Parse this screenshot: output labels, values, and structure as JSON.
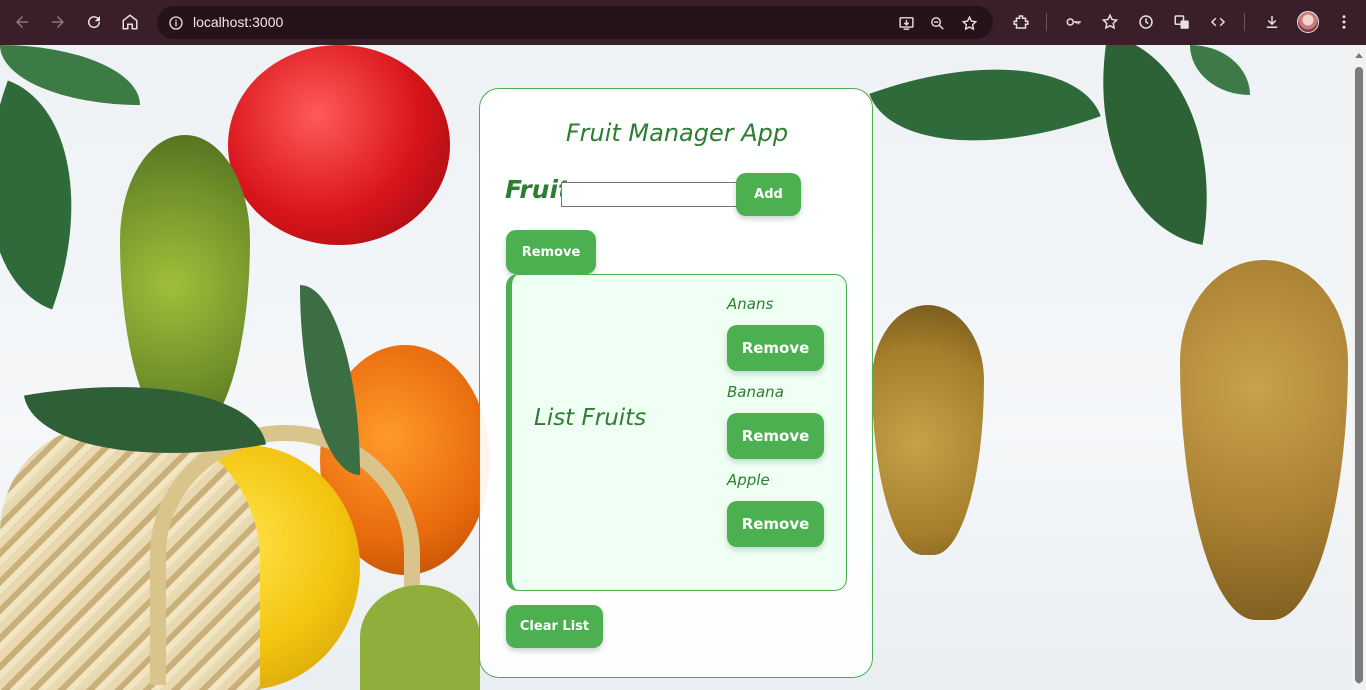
{
  "browser": {
    "url": "localhost:3000"
  },
  "app": {
    "title": "Fruit Manager App",
    "fruit_label": "Fruit",
    "fruit_input_value": "",
    "add_label": "Add",
    "remove_label": "Remove",
    "list_title": "List Fruits",
    "clear_label": "Clear List",
    "fruits": [
      {
        "name": "Anans",
        "remove_label": "Remove"
      },
      {
        "name": "Banana",
        "remove_label": "Remove"
      },
      {
        "name": "Apple",
        "remove_label": "Remove"
      }
    ]
  },
  "colors": {
    "accent": "#4caf50",
    "text_green": "#2e7d32",
    "list_bg": "#f0fff3",
    "chrome_bg": "#3a1f2b"
  }
}
